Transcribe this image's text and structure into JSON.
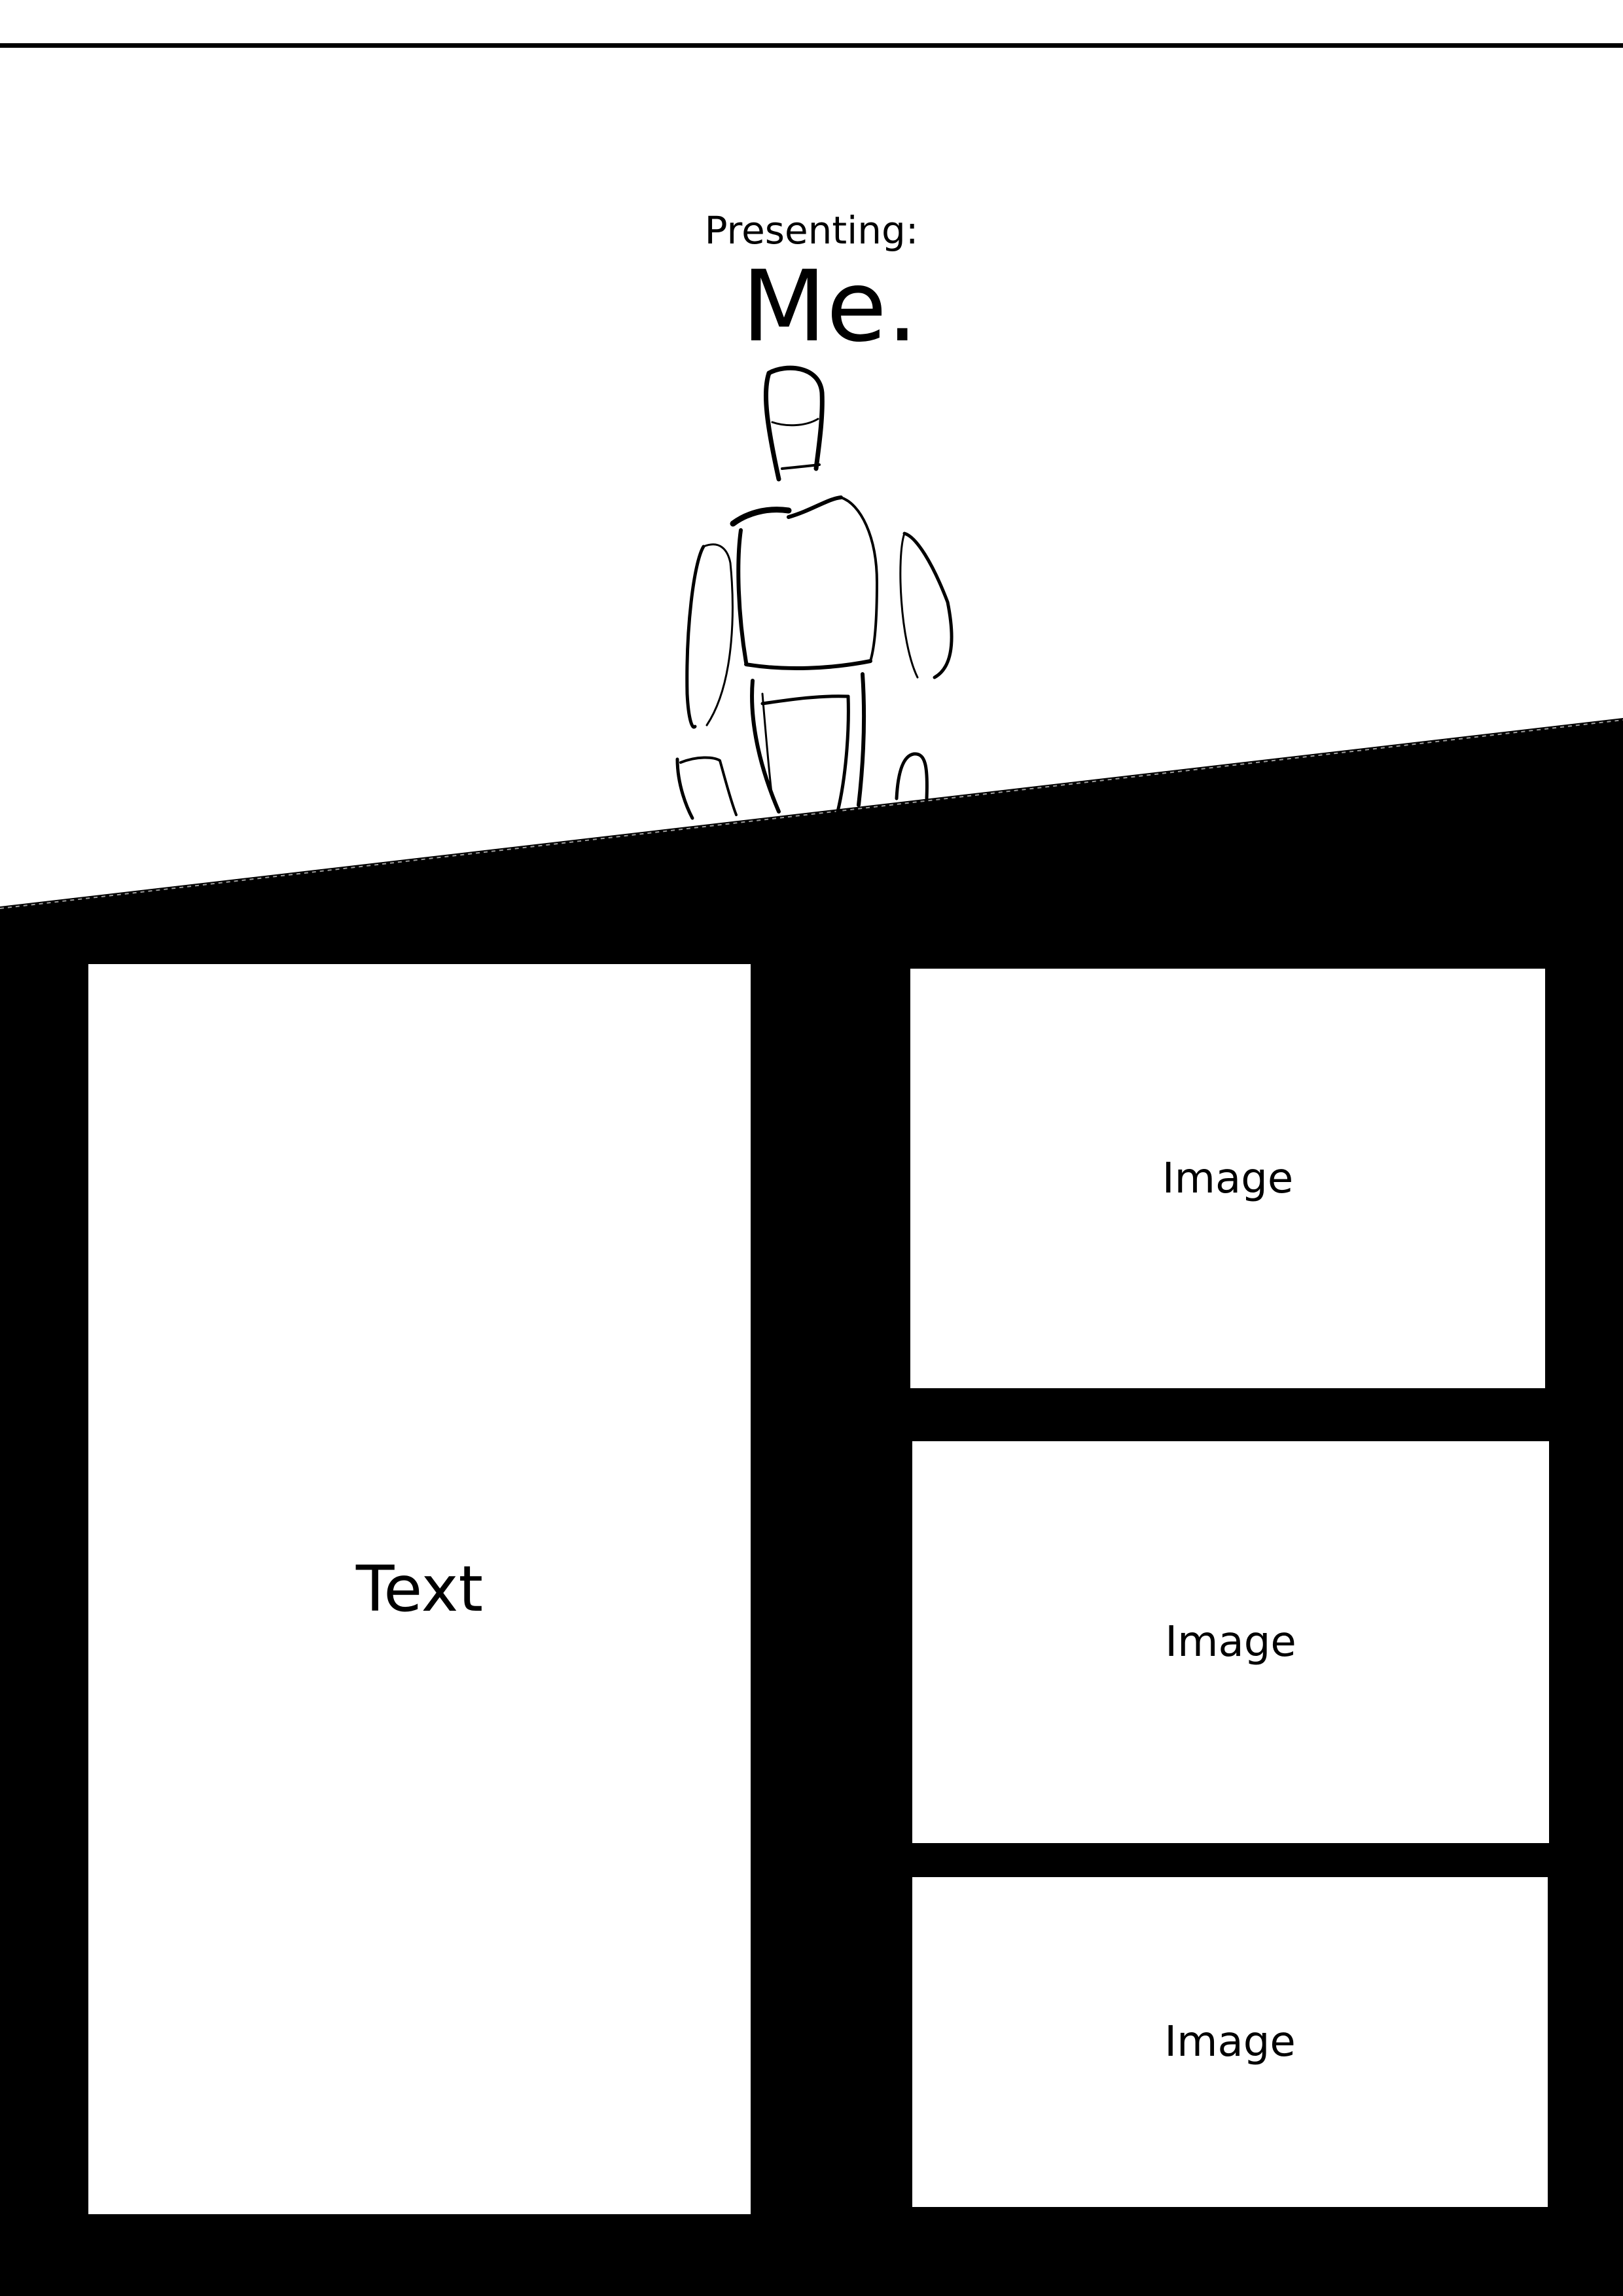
{
  "header": {
    "presenting": "Presenting:",
    "title": "Me."
  },
  "figure": {
    "icon": "person-sketch-icon"
  },
  "panels": {
    "text_label": "Text",
    "images": [
      {
        "label": "Image"
      },
      {
        "label": "Image"
      },
      {
        "label": "Image"
      }
    ]
  },
  "colors": {
    "background": "#ffffff",
    "ink": "#000000"
  }
}
